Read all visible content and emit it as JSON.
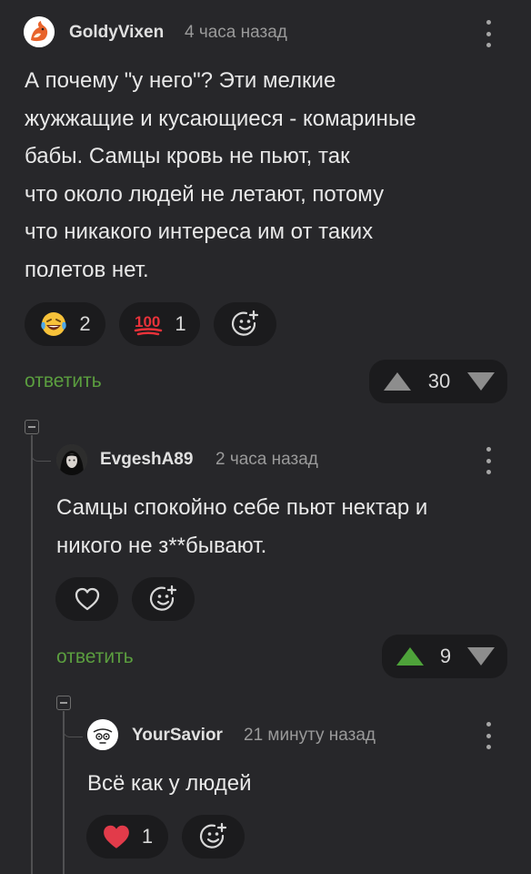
{
  "comments": [
    {
      "author": "GoldyVixen",
      "time": "4 часа назад",
      "lines": [
        "А почему \"у него\"? Эти мелкие",
        "жужжащие и кусающиеся - комариные",
        "бабы. Самцы кровь не пьют, так",
        "что около людей не летают, потому",
        "что никакого интереса им от таких",
        "полетов нет."
      ],
      "reactions": [
        {
          "icon": "laughing-tears-emoji",
          "count": "2"
        },
        {
          "icon": "hundred-points-emoji",
          "count": "1"
        }
      ],
      "reply_label": "ответить",
      "rating": "30",
      "vote_state": "none"
    },
    {
      "author": "EvgeshA89",
      "time": "2 часа назад",
      "lines": [
        "Самцы спокойно себе пьют нектар и",
        "никого не з**бывают."
      ],
      "reply_label": "ответить",
      "rating": "9",
      "vote_state": "up"
    },
    {
      "author": "YourSavior",
      "time": "21 минуту назад",
      "lines": [
        "Всё как у людей"
      ],
      "reactions": [
        {
          "icon": "heart-emoji",
          "count": "1"
        }
      ]
    }
  ],
  "colors": {
    "background": "#27272a",
    "accent_green": "#5b9e3f",
    "upvote_active": "#4ea33a",
    "heart": "#e23b4a"
  }
}
